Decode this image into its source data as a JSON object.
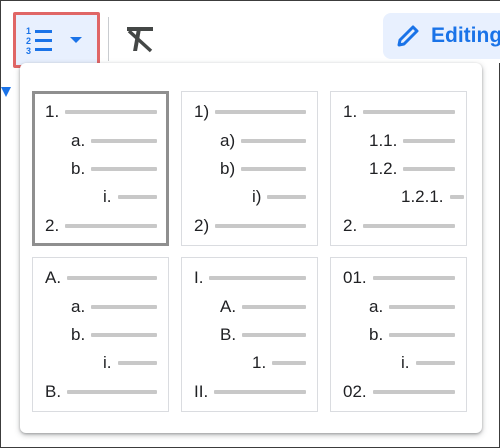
{
  "toolbar": {
    "numbered_list_icon": "numbered-list-icon",
    "dropdown_icon": "caret-down-icon",
    "clear_formatting_icon": "clear-formatting-icon",
    "editing_icon": "pencil-icon",
    "editing_label": "Editing"
  },
  "colors": {
    "accent": "#1a73e8",
    "highlight_border": "#e06666",
    "selected_border": "#8f8f8f",
    "line_gray": "#c8c8c8"
  },
  "presets": [
    {
      "selected": true,
      "items": [
        {
          "marker": "1.",
          "level": 0
        },
        {
          "marker": "a.",
          "level": 1
        },
        {
          "marker": "b.",
          "level": 1
        },
        {
          "marker": "i.",
          "level": 2
        },
        {
          "marker": "2.",
          "level": 0
        }
      ]
    },
    {
      "selected": false,
      "items": [
        {
          "marker": "1)",
          "level": 0
        },
        {
          "marker": "a)",
          "level": 1
        },
        {
          "marker": "b)",
          "level": 1
        },
        {
          "marker": "i)",
          "level": 2
        },
        {
          "marker": "2)",
          "level": 0
        }
      ]
    },
    {
      "selected": false,
      "items": [
        {
          "marker": "1.",
          "level": 0
        },
        {
          "marker": "1.1.",
          "level": 1
        },
        {
          "marker": "1.2.",
          "level": 1
        },
        {
          "marker": "1.2.1.",
          "level": 2
        },
        {
          "marker": "2.",
          "level": 0
        }
      ]
    },
    {
      "selected": false,
      "items": [
        {
          "marker": "A.",
          "level": 0
        },
        {
          "marker": "a.",
          "level": 1
        },
        {
          "marker": "b.",
          "level": 1
        },
        {
          "marker": "i.",
          "level": 2
        },
        {
          "marker": "B.",
          "level": 0
        }
      ]
    },
    {
      "selected": false,
      "items": [
        {
          "marker": "I.",
          "level": 0
        },
        {
          "marker": "A.",
          "level": 1
        },
        {
          "marker": "B.",
          "level": 1
        },
        {
          "marker": "1.",
          "level": 2
        },
        {
          "marker": "II.",
          "level": 0
        }
      ]
    },
    {
      "selected": false,
      "items": [
        {
          "marker": "01.",
          "level": 0
        },
        {
          "marker": "a.",
          "level": 1
        },
        {
          "marker": "b.",
          "level": 1
        },
        {
          "marker": "i.",
          "level": 2
        },
        {
          "marker": "02.",
          "level": 0
        }
      ]
    }
  ]
}
